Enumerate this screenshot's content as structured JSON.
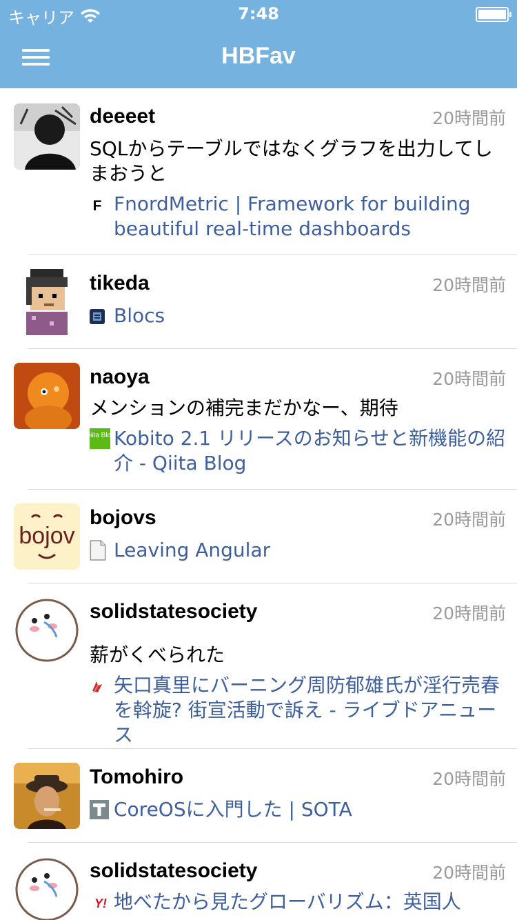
{
  "status": {
    "carrier": "キャリア",
    "time": "7:48"
  },
  "nav": {
    "title": "HBFav"
  },
  "entries": [
    {
      "user": "deeeet",
      "time": "20時間前",
      "comment": "SQLからテーブルではなくグラフを出力してしまおうと",
      "link": "FnordMetric | Framework for building beautiful real-time dashboards"
    },
    {
      "user": "tikeda",
      "time": "20時間前",
      "comment": "",
      "link": "Blocs"
    },
    {
      "user": "naoya",
      "time": "20時間前",
      "comment": "メンションの補完まだかなー、期待",
      "link": "Kobito 2.1 リリースのお知らせと新機能の紹介 - Qiita Blog"
    },
    {
      "user": "bojovs",
      "time": "20時間前",
      "comment": "",
      "link": "Leaving Angular",
      "avatar_text": "bojov"
    },
    {
      "user": "solidstatesociety",
      "time": "20時間前",
      "comment": "薪がくべられた",
      "link": "矢口真里にバーニング周防郁雄氏が淫行売春を斡旋? 街宣活動で訴え - ライブドアニュース"
    },
    {
      "user": "Tomohiro",
      "time": "20時間前",
      "comment": "",
      "link": "CoreOSに入門した | SOTA"
    },
    {
      "user": "solidstatesociety",
      "time": "20時間前",
      "comment": "",
      "link": "地べたから見たグローバリズム：英国人"
    }
  ],
  "favicons": {
    "fnord": "F",
    "qiita": "Qiita Blog",
    "yahoo": "Y!"
  }
}
